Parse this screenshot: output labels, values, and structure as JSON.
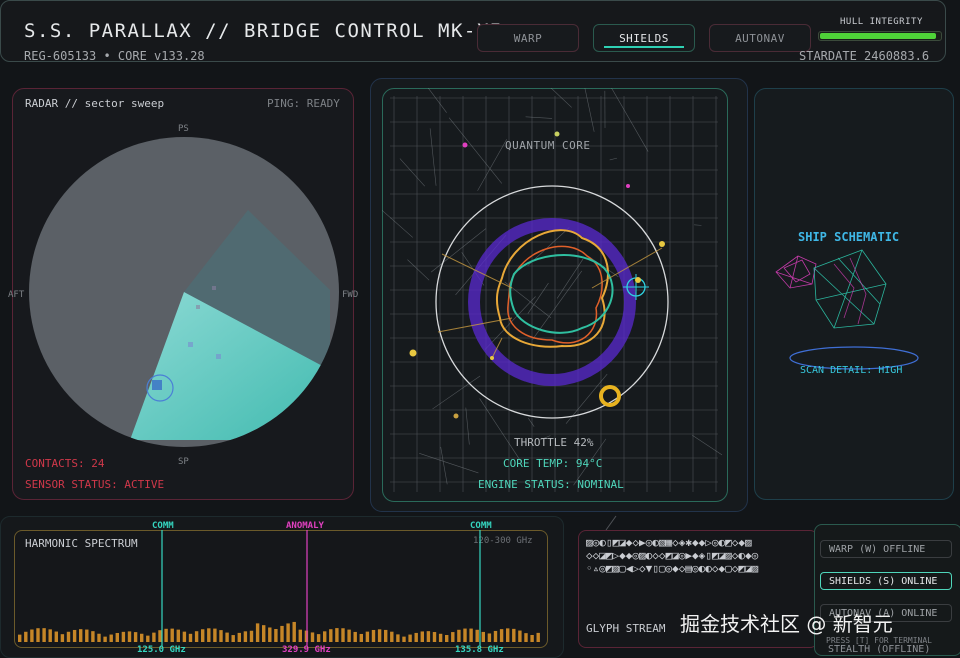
{
  "header": {
    "title": "S.S. PARALLAX // BRIDGE CONTROL MK-XI",
    "registry": "REG-605133 • CORE v133.28",
    "stardate": "STARDATE 2460883.6",
    "tabs": [
      {
        "label": "WARP",
        "active": false
      },
      {
        "label": "SHIELDS",
        "active": true
      },
      {
        "label": "AUTONAV",
        "active": false
      }
    ],
    "hull_label": "HULL INTEGRITY",
    "hull_level": 0.97
  },
  "radar": {
    "title": "RADAR // sector sweep",
    "ping": "PING: READY",
    "compass": {
      "north": "PS",
      "south": "SP",
      "west": "AFT",
      "east": "FWD"
    },
    "contacts": "CONTACTS: 24",
    "sensor_status": "SENSOR STATUS: ACTIVE"
  },
  "core": {
    "title": "QUANTUM CORE",
    "throttle": "THROTTLE 42%",
    "temp": "CORE TEMP: 94°C",
    "engine_status": "ENGINE STATUS: NOMINAL"
  },
  "schematic": {
    "title": "SHIP SCHEMATIC",
    "scan_detail": "SCAN DETAIL: HIGH"
  },
  "spectrum": {
    "title": "HARMONIC SPECTRUM",
    "range": "120-300 GHz",
    "markers": [
      {
        "label": "COMM",
        "freq": "125.0 GHz",
        "color": "#35d6c0"
      },
      {
        "label": "ANOMALY",
        "freq": "329.9 GHz",
        "color": "#e040c0"
      },
      {
        "label": "COMM",
        "freq": "135.8 GHz",
        "color": "#35d6c0"
      }
    ]
  },
  "glyph": {
    "rows": [
      "▨◎◐▯◩◪◆◇▶◎◐▧▦◇◈✱◆◆▷◎◐◩◇◆▨",
      "◇◇◪◩▷◆◆◎▨◐◇◇◩◪◎▶◆◈▯◩◪▨◇◐◆◎",
      "◦▵◎◩▨▢◀▷◇▼▯▢◎◆◇▤◎◐◐◇◆▢◇◩◪▨"
    ],
    "label": "GLYPH STREAM"
  },
  "systems": {
    "items": [
      {
        "label": "WARP (W) OFFLINE",
        "on": false
      },
      {
        "label": "SHIELDS (S) ONLINE",
        "on": true
      },
      {
        "label": "AUTONAV (A) ONLINE",
        "on": false
      }
    ],
    "hint": "PRESS [T] FOR TERMINAL",
    "stealth": "STEALTH (OFFLINE)"
  },
  "watermark": "掘金技术社区 @ 新智元",
  "colors": {
    "accent_teal": "#2fd1b4",
    "alert_red": "#d0384a",
    "hull_green": "#4fd338",
    "schematic_blue": "#3fb7e6",
    "spectrum_orange": "#e59a2a",
    "anomaly_magenta": "#e040c0"
  }
}
